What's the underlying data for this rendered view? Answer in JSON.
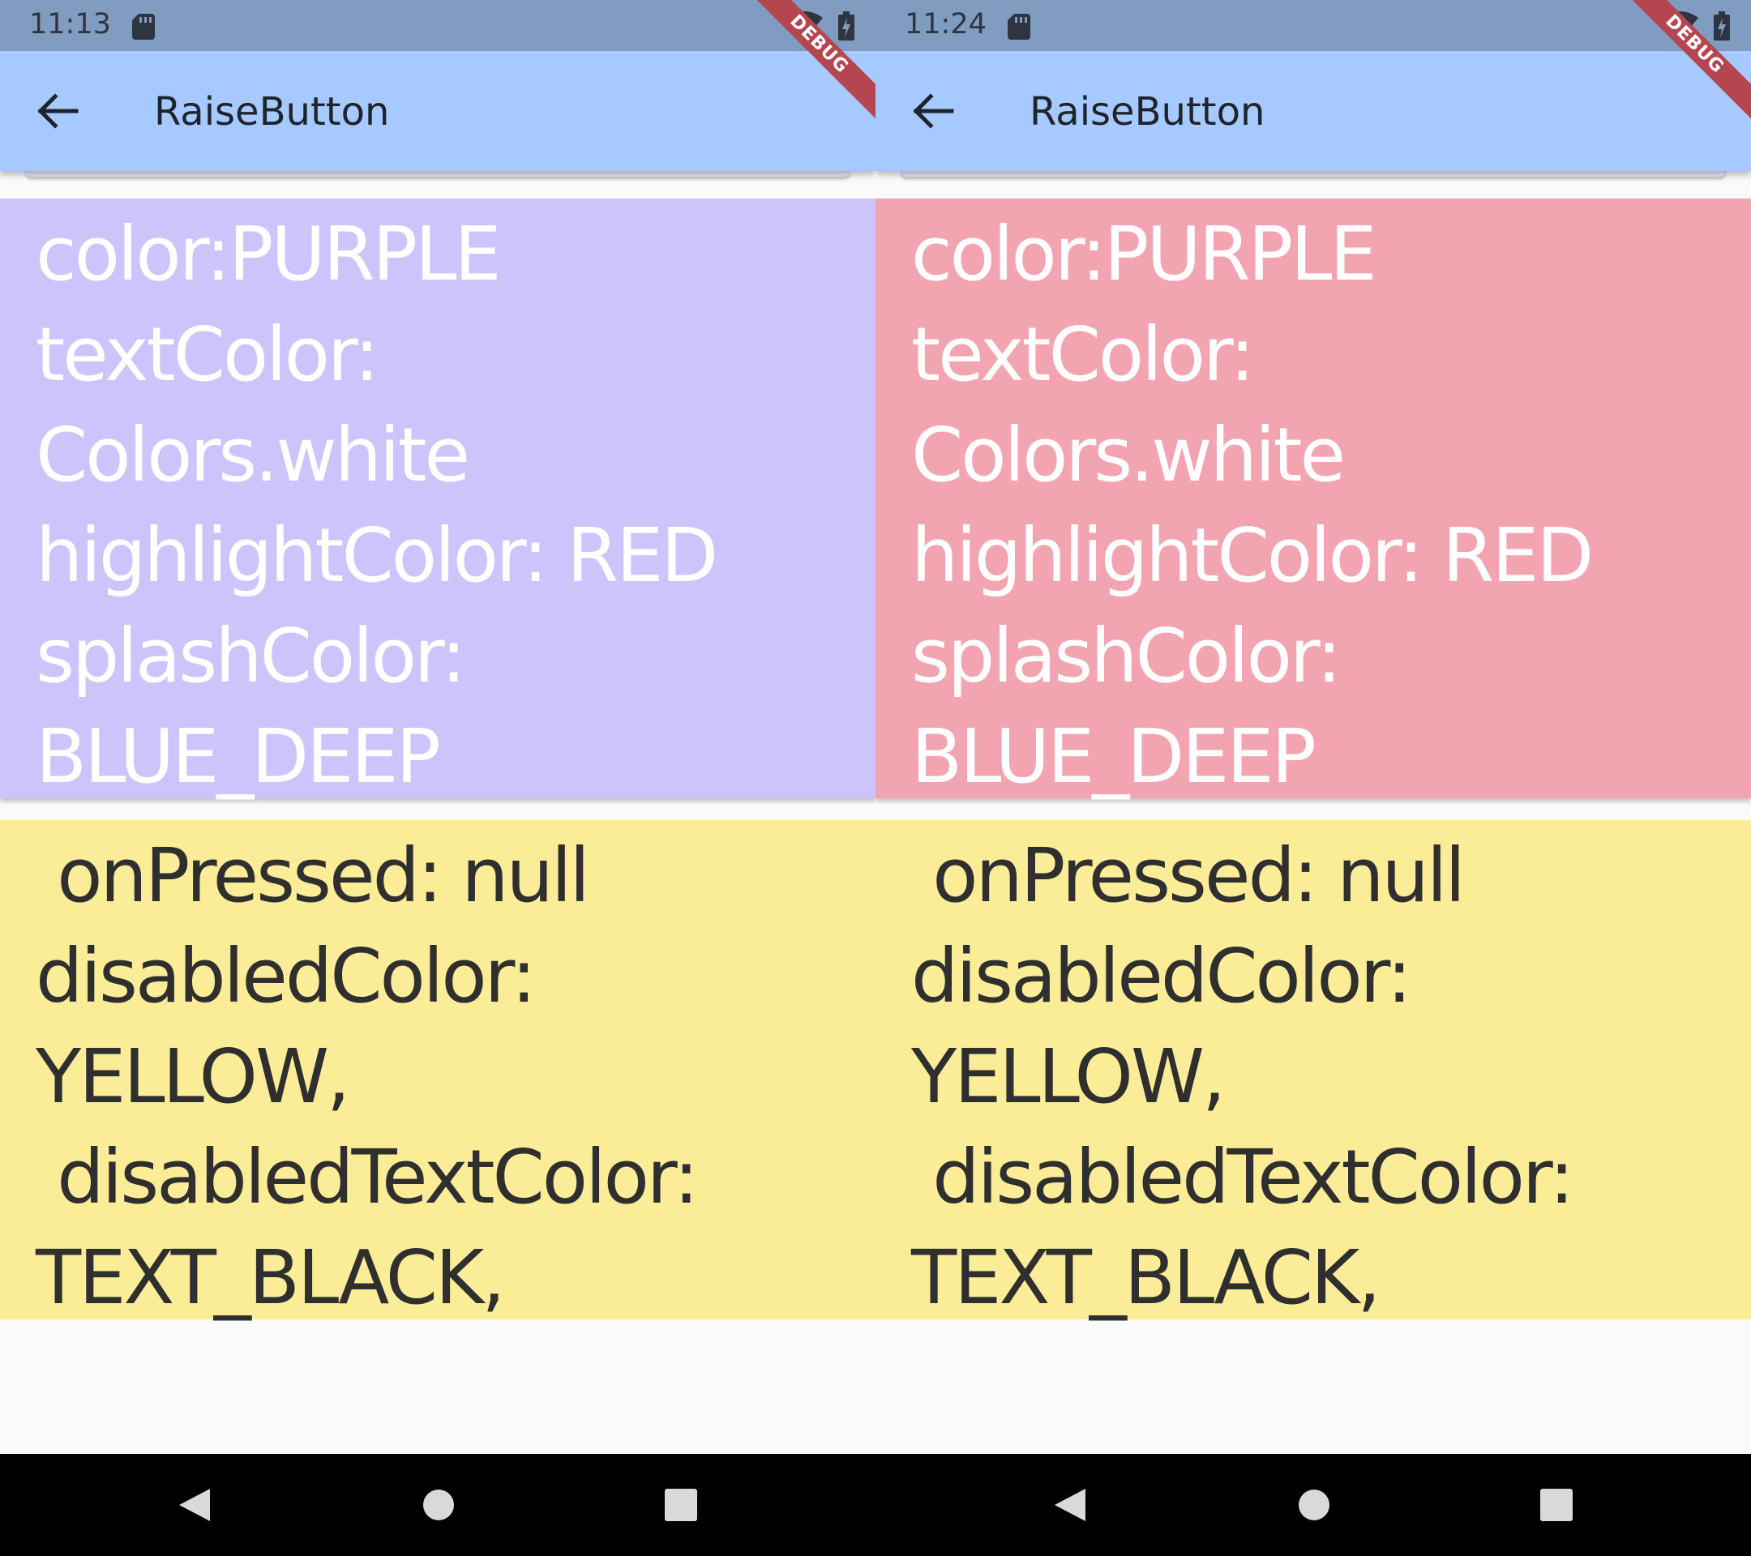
{
  "phones": [
    {
      "status_time": "11:13",
      "app_title": "RaiseButton",
      "debug_label": "DEBUG",
      "enabled_card": {
        "background": "#ccc4fa",
        "lines": [
          "color:PURPLE",
          "textColor:",
          "Colors.white",
          "highlightColor: RED",
          "splashColor:",
          "BLUE_DEEP"
        ]
      },
      "disabled_card": {
        "background": "#fbec97",
        "lines": [
          " onPressed: null",
          "disabledColor:",
          "YELLOW,",
          " disabledTextColor:",
          "TEXT_BLACK,"
        ]
      }
    },
    {
      "status_time": "11:24",
      "app_title": "RaiseButton",
      "debug_label": "DEBUG",
      "enabled_card": {
        "background": "#f2a5b0",
        "lines": [
          "color:PURPLE",
          "textColor:",
          "Colors.white",
          "highlightColor: RED",
          "splashColor:",
          "BLUE_DEEP"
        ]
      },
      "disabled_card": {
        "background": "#fbec97",
        "lines": [
          " onPressed: null",
          "disabledColor:",
          "YELLOW,",
          " disabledTextColor:",
          "TEXT_BLACK,"
        ]
      }
    }
  ],
  "icons": {
    "status_left": "sd-card-icon",
    "status_right": [
      "wifi-off-icon",
      "battery-icon"
    ],
    "appbar": "back-arrow-icon",
    "nav": [
      "back-triangle-icon",
      "home-circle-icon",
      "recents-square-icon"
    ]
  },
  "colors": {
    "statusbar": "#819cc1",
    "appbar": "#a6c9ff",
    "debug_banner": "#b5454f",
    "navbar": "#000000"
  }
}
